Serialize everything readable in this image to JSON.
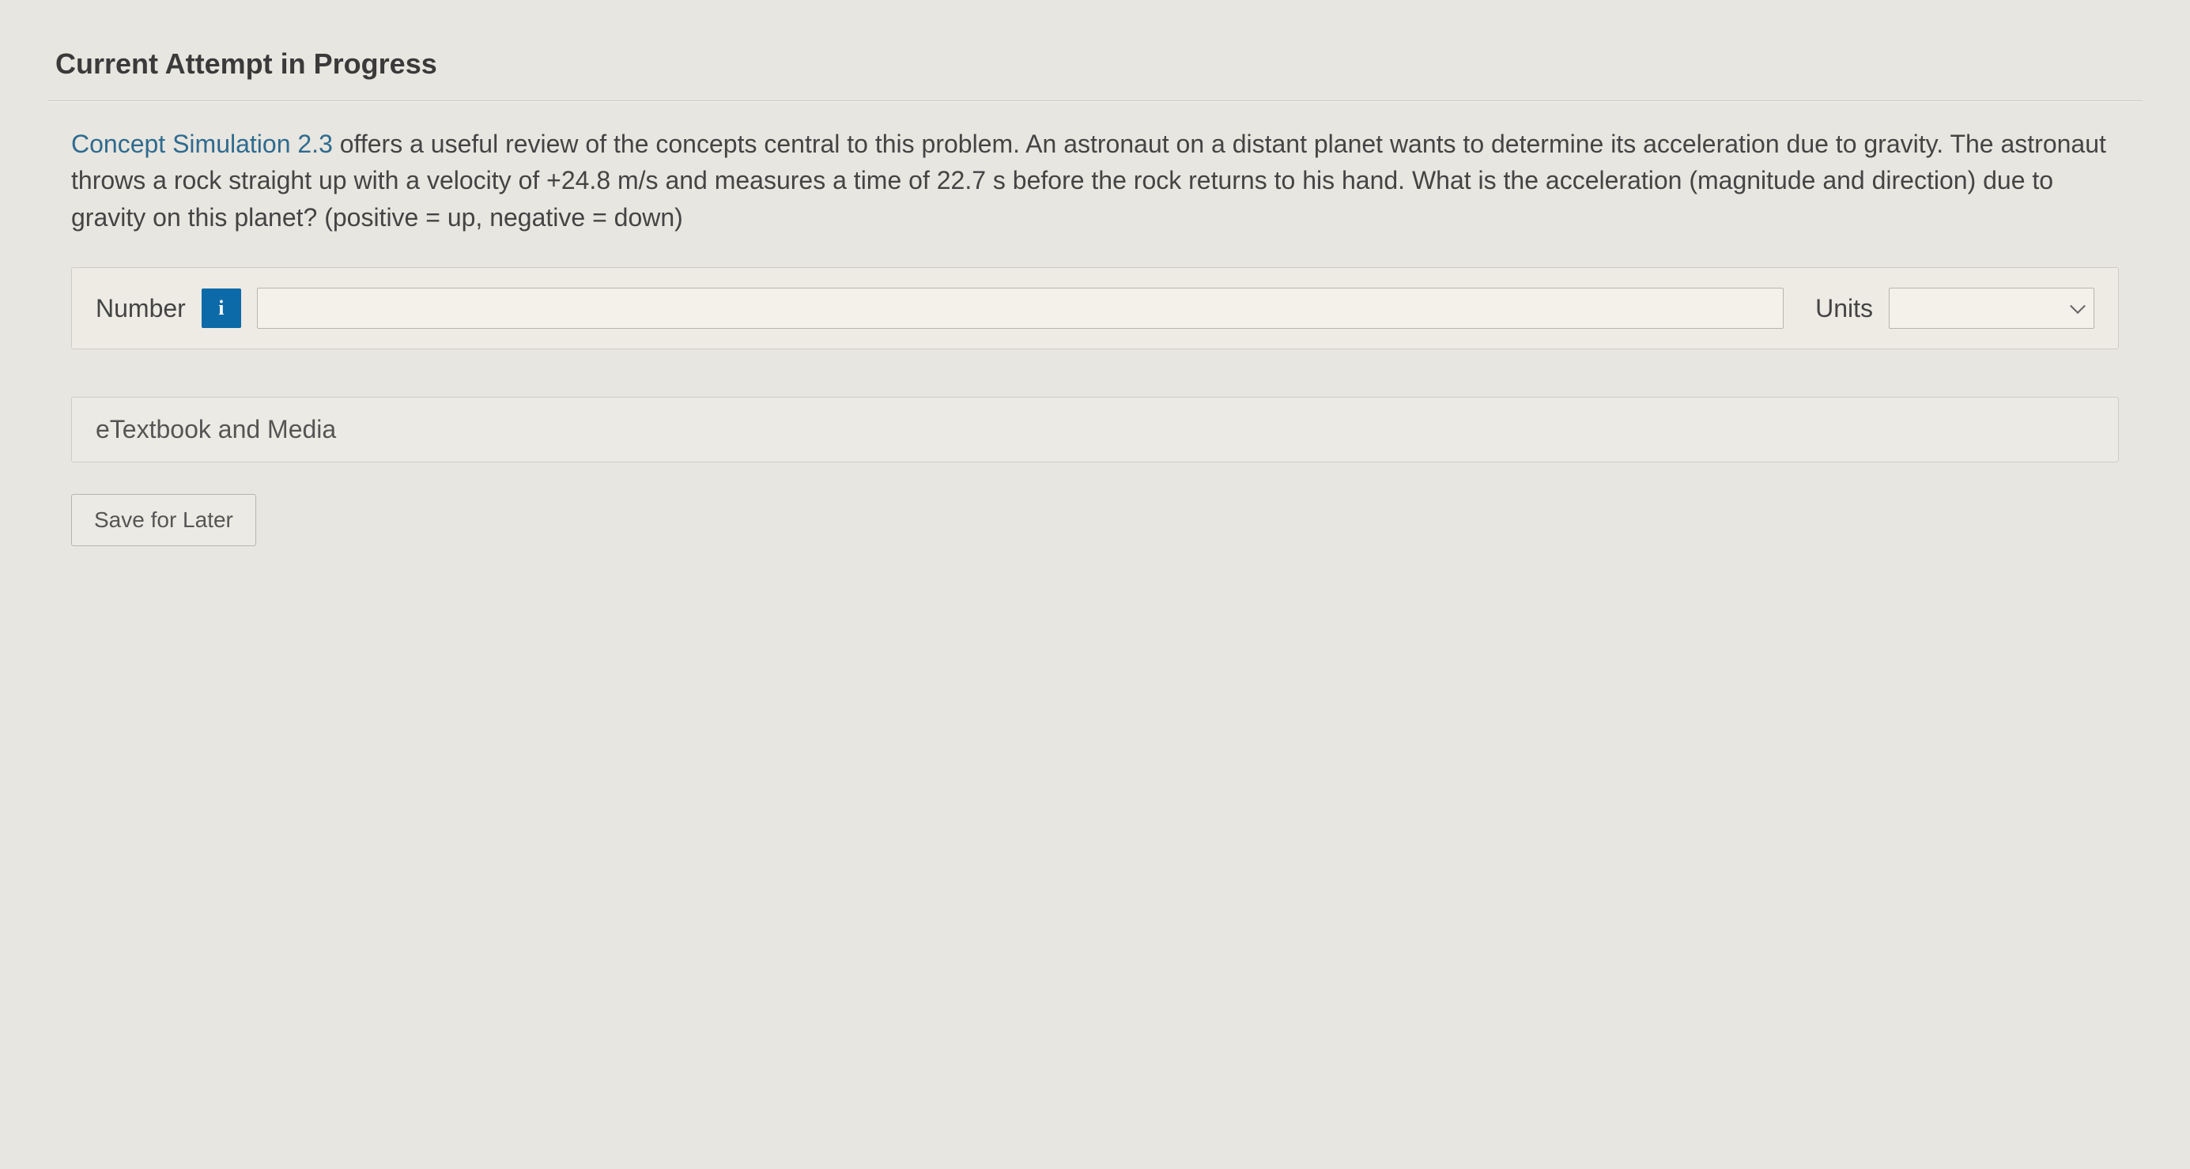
{
  "section_title": "Current Attempt in Progress",
  "question": {
    "sim_link_text": "Concept Simulation 2.3",
    "body_text": " offers a useful review of the concepts central to this problem. An astronaut on a distant planet wants to determine its acceleration due to gravity. The astronaut throws a rock straight up with a velocity of +24.8 m/s and measures a time of 22.7 s before the rock returns to his hand. What is the acceleration (magnitude and direction) due to gravity on this planet? (positive = up, negative = down)"
  },
  "answer": {
    "number_label": "Number",
    "info_badge": "i",
    "number_value": "",
    "units_label": "Units",
    "units_value": ""
  },
  "etextbook_label": "eTextbook and Media",
  "save_label": "Save for Later"
}
